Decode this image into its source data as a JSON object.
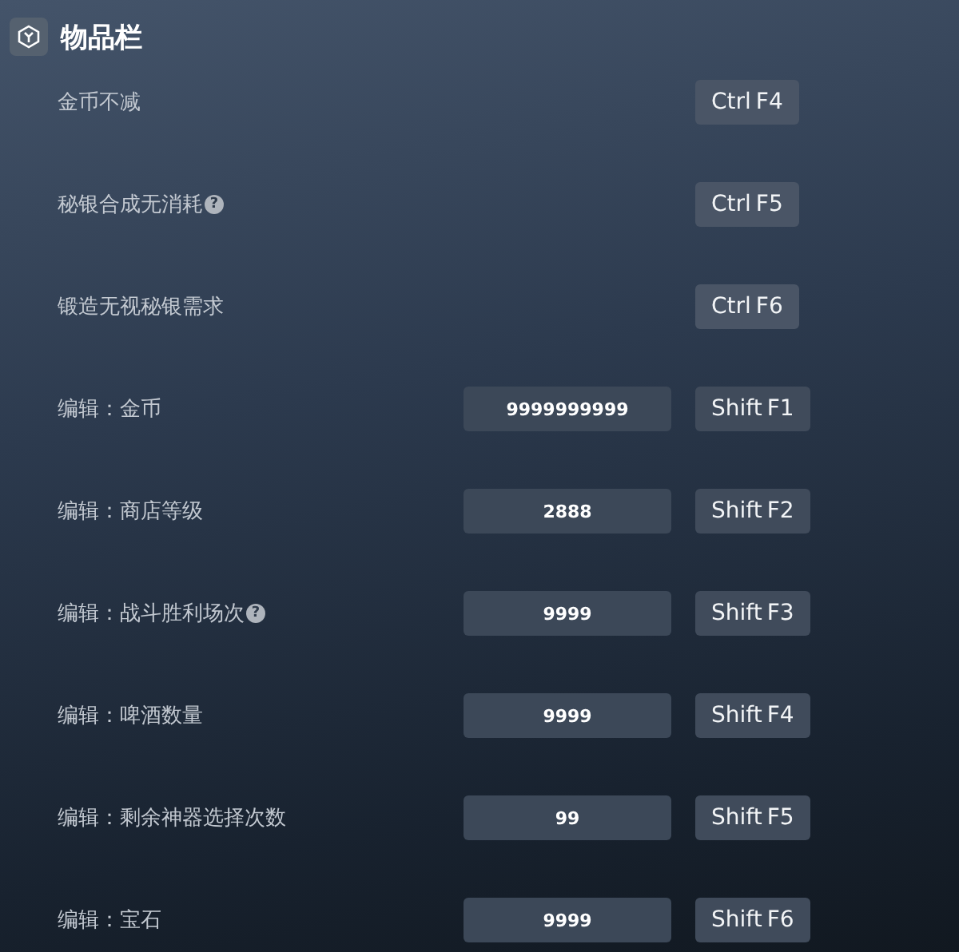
{
  "section": {
    "title": "物品栏"
  },
  "rows": [
    {
      "kind": "toggle",
      "label": "金币不减",
      "keys": [
        "Ctrl",
        "F4"
      ]
    },
    {
      "kind": "toggle",
      "label": "秘银合成无消耗",
      "help": "?",
      "keys": [
        "Ctrl",
        "F5"
      ]
    },
    {
      "kind": "toggle",
      "label": "锻造无视秘银需求",
      "keys": [
        "Ctrl",
        "F6"
      ]
    },
    {
      "kind": "edit",
      "label": "编辑：金币",
      "value": "9999999999",
      "keys": [
        "Shift",
        "F1"
      ]
    },
    {
      "kind": "edit",
      "label": "编辑：商店等级",
      "value": "2888",
      "keys": [
        "Shift",
        "F2"
      ]
    },
    {
      "kind": "edit",
      "label": "编辑：战斗胜利场次",
      "help": "?",
      "value": "9999",
      "keys": [
        "Shift",
        "F3"
      ]
    },
    {
      "kind": "edit",
      "label": "编辑：啤酒数量",
      "value": "9999",
      "keys": [
        "Shift",
        "F4"
      ]
    },
    {
      "kind": "edit",
      "label": "编辑：剩余神器选择次数",
      "value": "99",
      "keys": [
        "Shift",
        "F5"
      ]
    },
    {
      "kind": "edit",
      "label": "编辑：宝石",
      "value": "9999",
      "keys": [
        "Shift",
        "F6"
      ]
    }
  ]
}
